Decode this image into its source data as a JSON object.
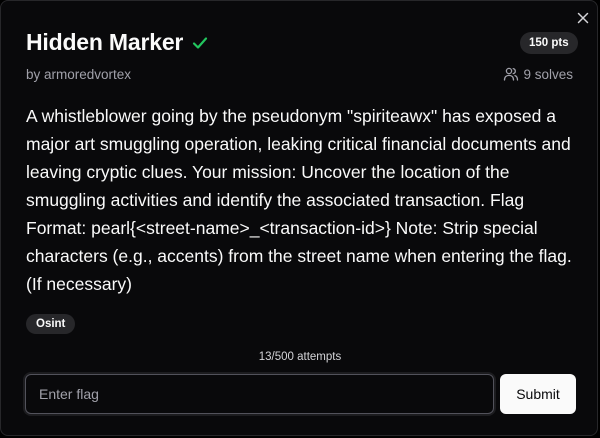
{
  "challenge": {
    "title": "Hidden Marker",
    "points": "150 pts",
    "author": "by armoredvortex",
    "solves": "9 solves",
    "description": "A whistleblower going by the pseudonym \"spiriteawx\" has exposed a major art smuggling operation, leaking critical financial documents and leaving cryptic clues. Your mission: Uncover the location of the smuggling activities and identify the associated transaction. Flag Format: pearl{<street-name>_<transaction-id>} Note: Strip special characters (e.g., accents) from the street name when entering the flag. (If necessary)",
    "tags": [
      "Osint"
    ],
    "attempts": "13/500 attempts",
    "solved": true
  },
  "form": {
    "flag_placeholder": "Enter flag",
    "flag_value": "",
    "submit_label": "Submit"
  },
  "icons": {
    "close": "close-icon",
    "solved": "check-icon",
    "solves": "users-icon"
  },
  "colors": {
    "background": "#09090b",
    "border": "#27272a",
    "badge": "#27272a",
    "solved_check": "#22c55e",
    "muted_text": "#a1a1aa",
    "submit_bg": "#fafafa"
  }
}
